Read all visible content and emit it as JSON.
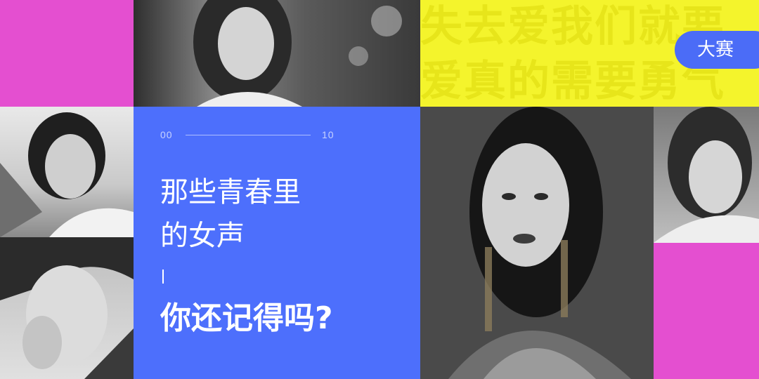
{
  "slogan": {
    "line1": "失去爱我们就要",
    "line2": "爱真的需要勇气"
  },
  "badge": {
    "label": "大赛"
  },
  "panel": {
    "counter_start": "00",
    "counter_end": "10",
    "title_line1": "那些青春里",
    "title_line2": "的女声",
    "headline": "你还记得吗?"
  },
  "colors": {
    "magenta": "#e44fd0",
    "yellow": "#f4f42c",
    "blue": "#4d6ffc",
    "badge_blue": "#4b6cf7"
  },
  "photos": [
    "portrait-top-center",
    "portrait-left-upper",
    "portrait-left-lower",
    "portrait-center-large",
    "portrait-right"
  ]
}
